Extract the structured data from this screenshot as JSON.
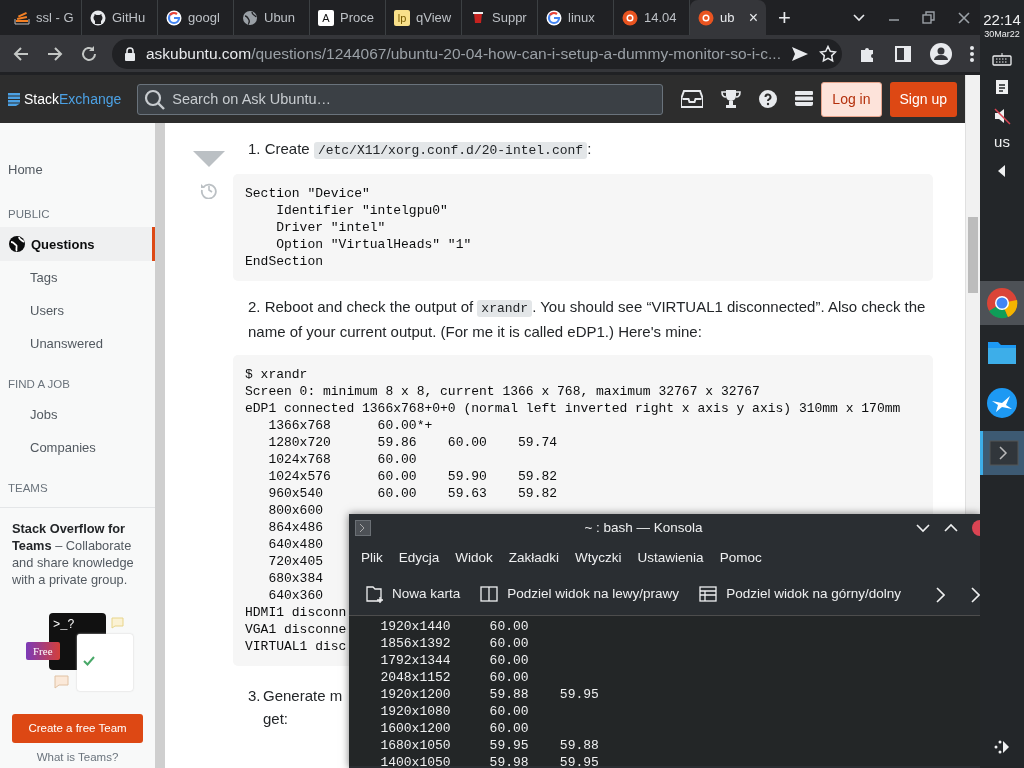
{
  "browser": {
    "tabs": [
      {
        "label": "ssl - G",
        "kind": "stack",
        "selected": false
      },
      {
        "label": "GitHu",
        "kind": "github",
        "selected": false
      },
      {
        "label": "googl",
        "kind": "google",
        "selected": false
      },
      {
        "label": "Ubun",
        "kind": "globe",
        "selected": false
      },
      {
        "label": "Proce",
        "kind": "letter",
        "glyph": "A",
        "selected": false
      },
      {
        "label": "qView",
        "kind": "letter",
        "glyph": "lp",
        "selected": false
      },
      {
        "label": "Suppr",
        "kind": "cup",
        "selected": false
      },
      {
        "label": "linux",
        "kind": "google",
        "selected": false
      },
      {
        "label": "14.04",
        "kind": "askubuntu",
        "selected": false
      },
      {
        "label": "ub",
        "kind": "askubuntu",
        "selected": true,
        "close": "×"
      }
    ],
    "new_tab": "+",
    "url": {
      "host": "askubuntu.com",
      "path": "/questions/1244067/ubuntu-20-04-how-can-i-setup-a-dummy-monitor-so-i-c..."
    }
  },
  "site_header": {
    "logo": {
      "first": "Stack",
      "second": "Exchange"
    },
    "search": {
      "placeholder": "Search on Ask Ubuntu…"
    },
    "buttons": [
      {
        "label": "Log in",
        "kind": "outline"
      },
      {
        "label": "Sign up",
        "kind": "primary"
      }
    ]
  },
  "sidebar": {
    "items": [
      {
        "kind": "link",
        "label": "Home",
        "selected": false
      },
      {
        "kind": "heading",
        "label": "PUBLIC"
      },
      {
        "kind": "link",
        "label": "Questions",
        "selected": true
      },
      {
        "kind": "sublink",
        "label": "Tags",
        "selected": false
      },
      {
        "kind": "sublink",
        "label": "Users",
        "selected": false
      },
      {
        "kind": "sublink",
        "label": "Unanswered",
        "selected": false
      },
      {
        "kind": "heading",
        "label": "FIND A JOB"
      },
      {
        "kind": "sublink",
        "label": "Jobs",
        "selected": false
      },
      {
        "kind": "sublink",
        "label": "Companies",
        "selected": false
      },
      {
        "kind": "heading",
        "label": "TEAMS"
      }
    ],
    "teams": {
      "text": "**Stack Overflow for Teams** – Collaborate and share knowledge with a private group.",
      "prompt": ">_?",
      "badge": "Free",
      "button": "Create a free Team",
      "link": "What is Teams?"
    }
  },
  "answer": {
    "blocks": [
      {
        "kind": "step",
        "parts": [
          {
            "kind": "text",
            "text": "1. Create "
          },
          {
            "kind": "code",
            "text": "/etc/X11/xorg.conf.d/20-intel.conf"
          },
          {
            "kind": "text",
            "text": ":"
          }
        ]
      },
      {
        "kind": "code",
        "lines": [
          "Section \"Device\"",
          "    Identifier \"intelgpu0\"",
          "    Driver \"intel\"",
          "    Option \"VirtualHeads\" \"1\"",
          "EndSection"
        ]
      },
      {
        "kind": "step",
        "parts": [
          {
            "kind": "text",
            "text": "2. Reboot and check the output of "
          },
          {
            "kind": "code",
            "text": "xrandr"
          },
          {
            "kind": "text",
            "text": ". You should see “VIRTUAL1 disconnected”. Also check the name of your current output. (For me it is called eDP1.) Here's mine:"
          }
        ]
      },
      {
        "kind": "code",
        "lines": [
          "$ xrandr",
          "Screen 0: minimum 8 x 8, current 1366 x 768, maximum 32767 x 32767",
          "eDP1 connected 1366x768+0+0 (normal left inverted right x axis y axis) 310mm x 170mm",
          "   1366x768      60.00*+",
          "   1280x720      59.86    60.00    59.74",
          "   1024x768      60.00",
          "   1024x576      60.00    59.90    59.82",
          "   960x540       60.00    59.63    59.82",
          "   800x600",
          "   864x486",
          "   640x480",
          "   720x405",
          "   680x384",
          "   640x360",
          "HDMI1 disconn",
          "VGA1 disconne",
          "VIRTUAL1 disc"
        ]
      },
      {
        "kind": "cut_step",
        "number": "3.",
        "lines": [
          "Generate m",
          "get:"
        ]
      }
    ]
  },
  "konsole": {
    "title": "~ : bash — Konsola",
    "menu": [
      "Plik",
      "Edycja",
      "Widok",
      "Zakładki",
      "Wtyczki",
      "Ustawienia",
      "Pomoc"
    ],
    "toolbar": [
      {
        "label": "Nowa karta",
        "kind": "new-tab"
      },
      {
        "label": "Podziel widok na lewy/prawy",
        "kind": "split-columns"
      },
      {
        "label": "Podziel widok na górny/dolny",
        "kind": "split-rows"
      }
    ],
    "output": [
      "   1920x1440     60.00",
      "   1856x1392     60.00",
      "   1792x1344     60.00",
      "   2048x1152     60.00",
      "   1920x1200     59.88    59.95",
      "   1920x1080     60.00",
      "   1600x1200     60.00",
      "   1680x1050     59.95    59.88",
      "   1400x1050     59.98    59.95"
    ]
  },
  "taskbar": {
    "time": "22:14",
    "date": "30Mar22",
    "layout": "us",
    "apps": [
      {
        "kind": "chrome",
        "selected": false,
        "hovered": true
      },
      {
        "kind": "folder",
        "selected": false,
        "hovered": false
      },
      {
        "kind": "bird",
        "selected": false,
        "hovered": false
      },
      {
        "kind": "terminal",
        "selected": true,
        "hovered": false
      }
    ]
  }
}
